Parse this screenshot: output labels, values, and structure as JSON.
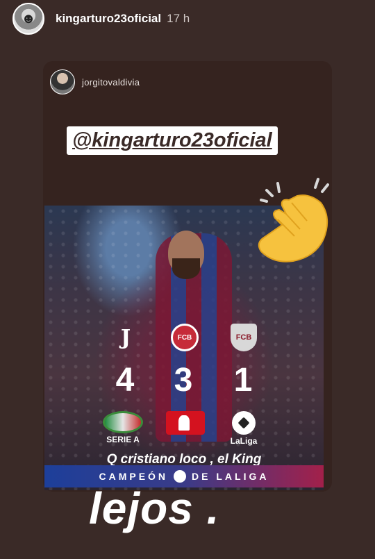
{
  "story": {
    "username": "kingarturo23oficial",
    "time": "17 h"
  },
  "repost": {
    "username": "jorgitovaldivia",
    "mention": "@kingarturo23oficial"
  },
  "graphic": {
    "teams": [
      {
        "name": "Juventus",
        "score": "4",
        "league_label": "SERIE A"
      },
      {
        "name": "Bayern",
        "score": "3",
        "league_label": ""
      },
      {
        "name": "Barcelona",
        "score": "1",
        "league_label": "LaLiga"
      }
    ],
    "caption": "Q cristiano loco , el King",
    "banner_left": "CAMPEÓN",
    "banner_right": "DE LALIGA"
  },
  "overlay_text": "lejos ."
}
